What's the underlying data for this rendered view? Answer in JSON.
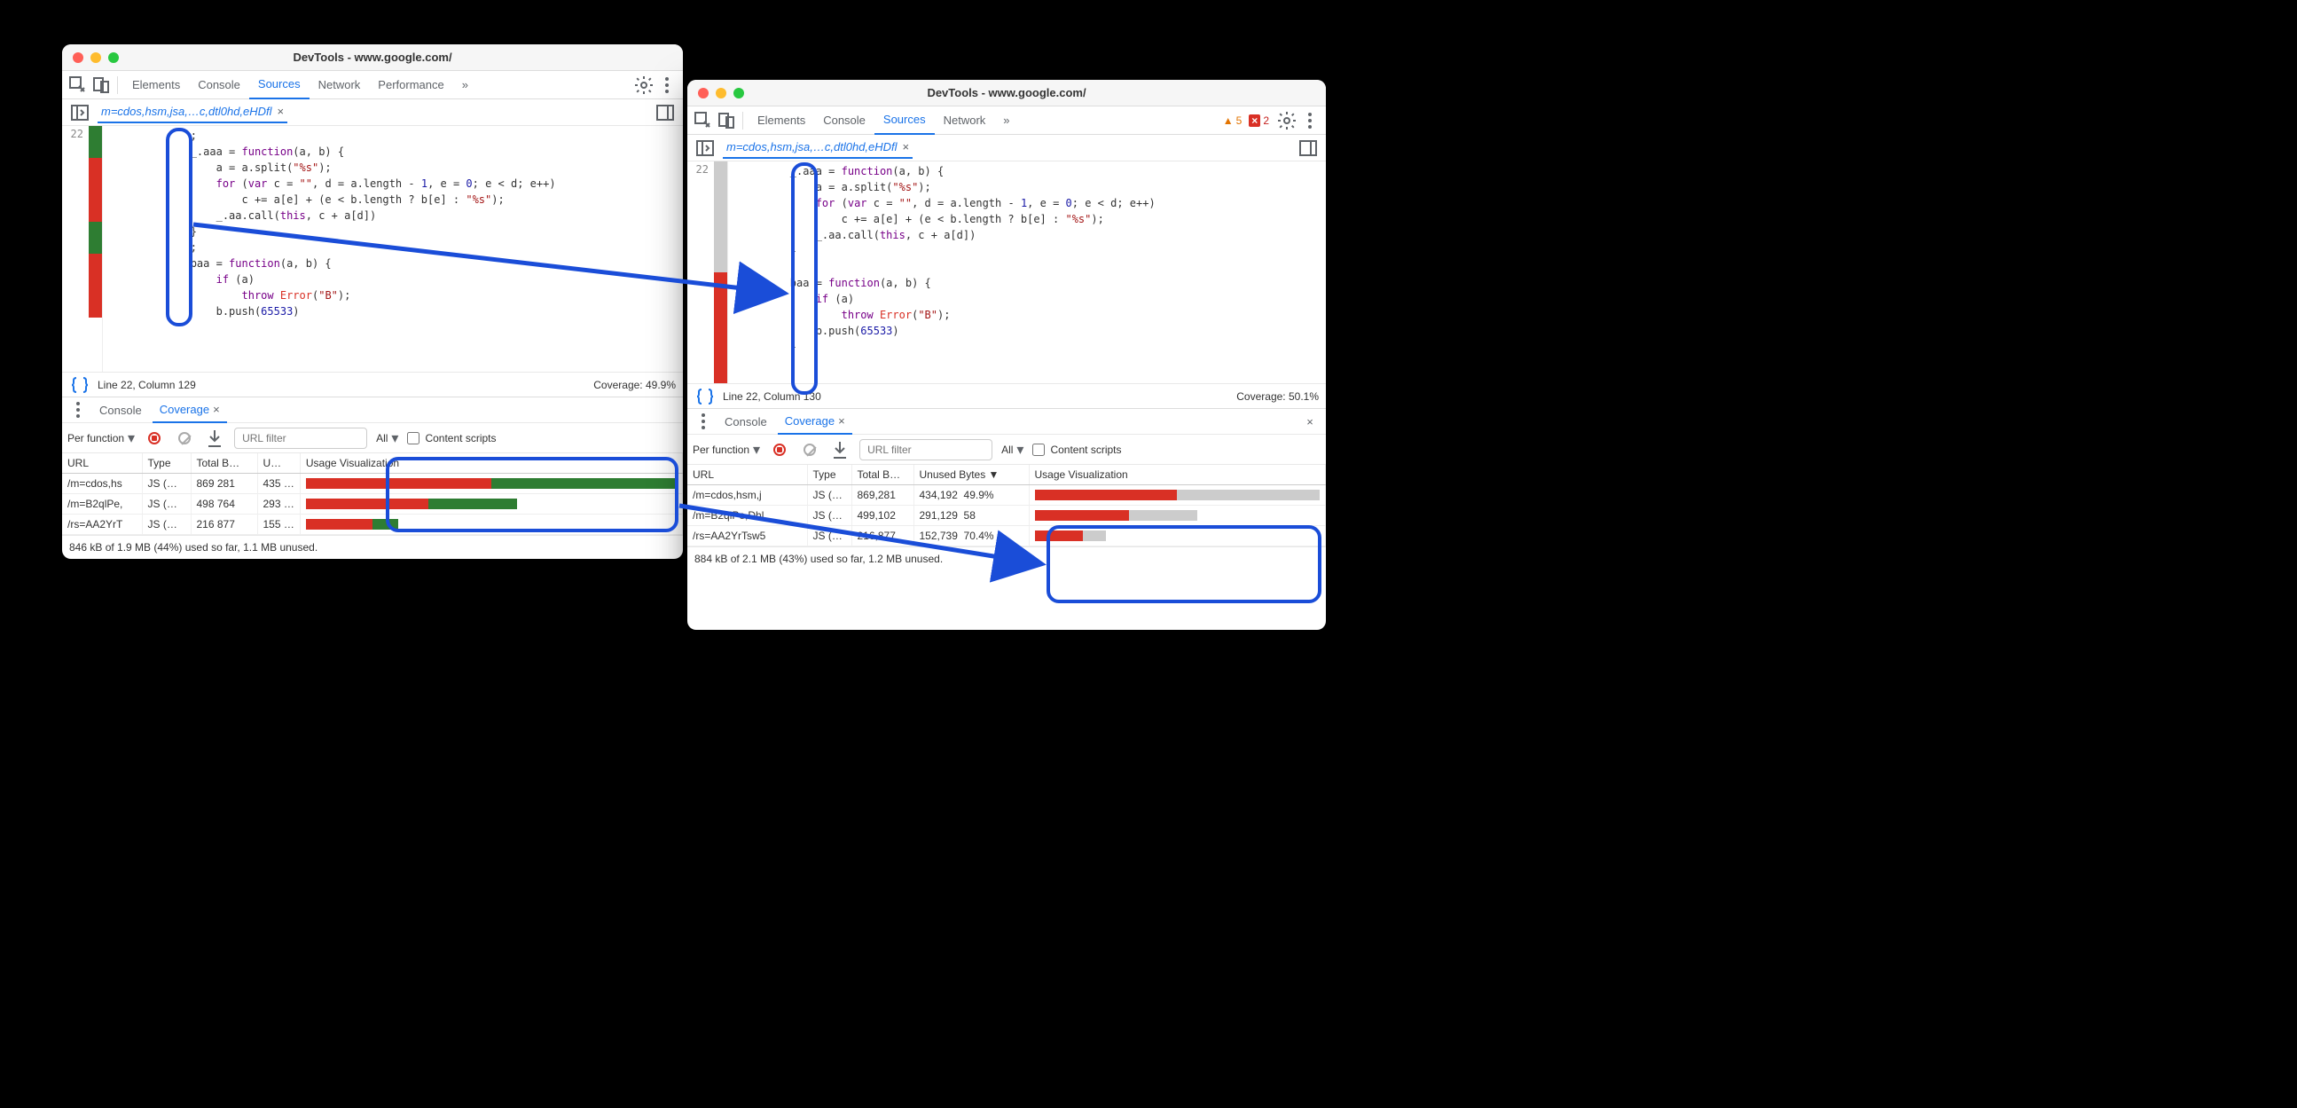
{
  "left": {
    "title": "DevTools - www.google.com/",
    "tabs": [
      "Elements",
      "Console",
      "Sources",
      "Network",
      "Performance"
    ],
    "active_tab": "Sources",
    "overflow": "»",
    "file_tab": "m=cdos,hsm,jsa,…c,dtl0hd,eHDfl",
    "line_no": "22",
    "code_lines": [
      "            ;",
      "            _.aaa = function(a, b) {",
      "                a = a.split(\"%s\");",
      "                for (var c = \"\", d = a.length - 1, e = 0; e < d; e++)",
      "                    c += a[e] + (e < b.length ? b[e] : \"%s\");",
      "                _.aa.call(this, c + a[d])",
      "            }",
      "            ;",
      "            baa = function(a, b) {",
      "                if (a)",
      "                    throw Error(\"B\");",
      "                b.push(65533)"
    ],
    "status_line": "Line 22, Column 129",
    "coverage_label": "Coverage: 49.9%",
    "drawer_tabs": [
      "Console",
      "Coverage"
    ],
    "drawer_active": "Coverage",
    "per_function": "Per function",
    "url_filter_placeholder": "URL filter",
    "all_label": "All",
    "content_scripts": "Content scripts",
    "table": {
      "headers": [
        "URL",
        "Type",
        "Total B…",
        "U…",
        "Usage Visualization"
      ],
      "rows": [
        {
          "url": "/m=cdos,hs",
          "type": "JS (…",
          "total": "869 281",
          "unused": "435 …",
          "viz": {
            "r": 50,
            "g": 50,
            "e": 0
          }
        },
        {
          "url": "/m=B2qlPe,",
          "type": "JS (…",
          "total": "498 764",
          "unused": "293 …",
          "viz": {
            "r": 33,
            "g": 24,
            "e": 43
          }
        },
        {
          "url": "/rs=AA2YrT",
          "type": "JS (…",
          "total": "216 877",
          "unused": "155 …",
          "viz": {
            "r": 18,
            "g": 7,
            "e": 75
          }
        }
      ]
    },
    "footer": "846 kB of 1.9 MB (44%) used so far, 1.1 MB unused."
  },
  "right": {
    "title": "DevTools - www.google.com/",
    "tabs": [
      "Elements",
      "Console",
      "Sources",
      "Network"
    ],
    "active_tab": "Sources",
    "overflow": "»",
    "warn_count": "5",
    "error_count": "2",
    "file_tab": "m=cdos,hsm,jsa,…c,dtl0hd,eHDfl",
    "line_no": "22",
    "code_lines": [
      "        _.aaa = function(a, b) {",
      "            a = a.split(\"%s\");",
      "            for (var c = \"\", d = a.length - 1, e = 0; e < d; e++)",
      "                c += a[e] + (e < b.length ? b[e] : \"%s\");",
      "            _.aa.call(this, c + a[d])",
      "        }",
      "        ;",
      "        baa = function(a, b) {",
      "            if (a)",
      "                throw Error(\"B\");",
      "            b.push(65533)",
      "        }"
    ],
    "status_line": "Line 22, Column 130",
    "coverage_label": "Coverage: 50.1%",
    "drawer_tabs": [
      "Console",
      "Coverage"
    ],
    "drawer_active": "Coverage",
    "per_function": "Per function",
    "url_filter_placeholder": "URL filter",
    "all_label": "All",
    "content_scripts": "Content scripts",
    "table": {
      "headers": [
        "URL",
        "Type",
        "Total B…",
        "Unused Bytes",
        "Usage Visualization"
      ],
      "sort_desc_on": "Unused Bytes",
      "rows": [
        {
          "url": "/m=cdos,hsm,j",
          "type": "JS (…",
          "total": "869,281",
          "unused": "434,192",
          "pct": "49.9%",
          "viz": {
            "r": 50,
            "n": 50,
            "e": 0
          }
        },
        {
          "url": "/m=B2qlPe,Dhl",
          "type": "JS (…",
          "total": "499,102",
          "unused": "291,129",
          "pct": "58",
          "viz": {
            "r": 33,
            "n": 24,
            "e": 43
          }
        },
        {
          "url": "/rs=AA2YrTsw5",
          "type": "JS (…",
          "total": "216,877",
          "unused": "152,739",
          "pct": "70.4%",
          "viz": {
            "r": 17,
            "n": 8,
            "e": 75
          }
        }
      ]
    },
    "footer": "884 kB of 2.1 MB (43%) used so far, 1.2 MB unused."
  }
}
